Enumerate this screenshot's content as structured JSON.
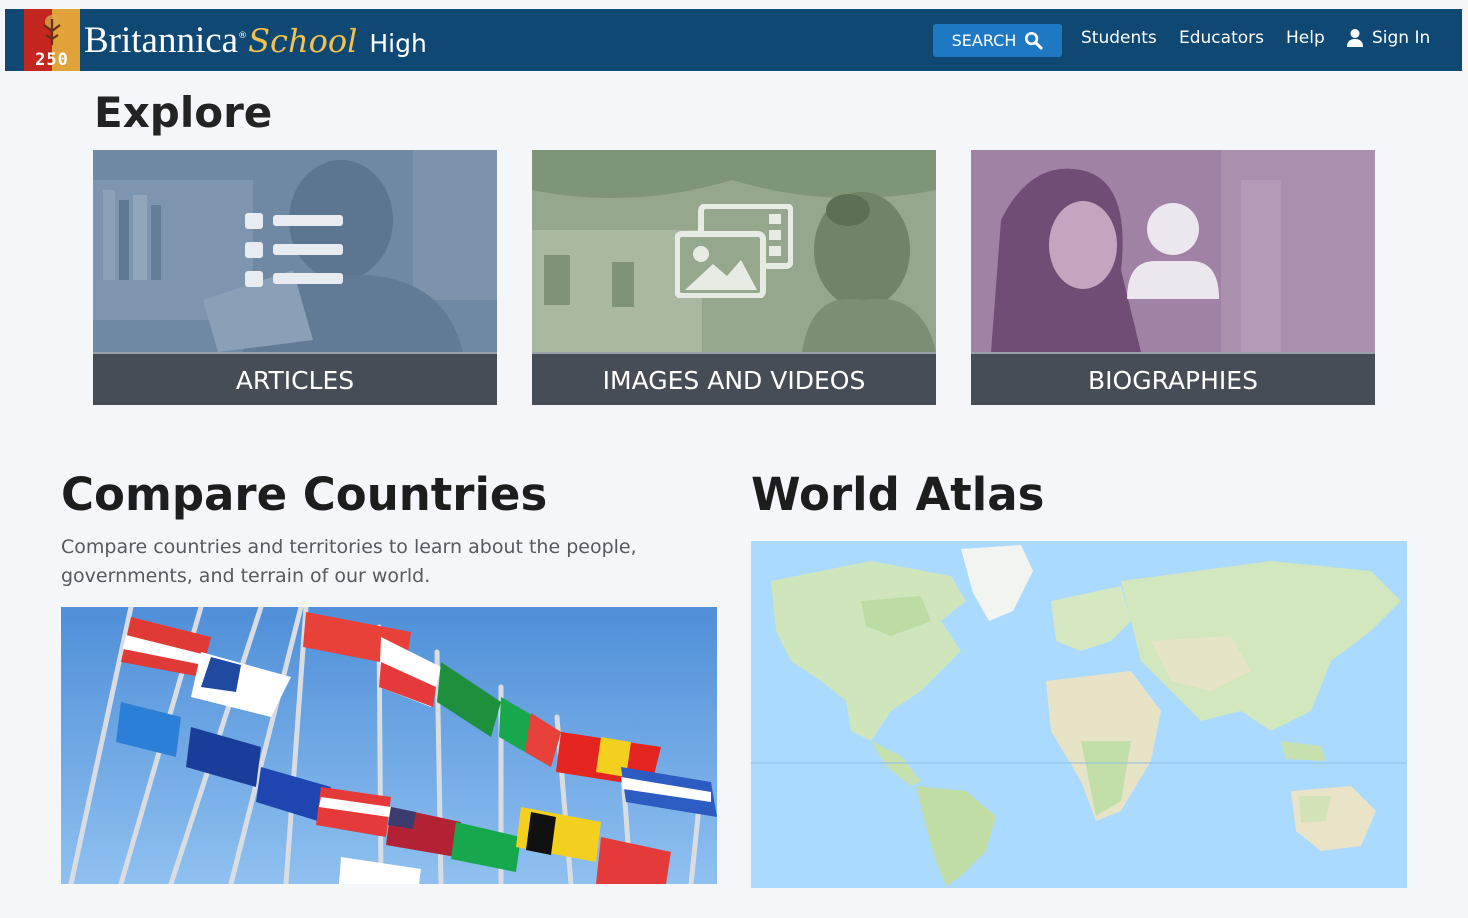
{
  "header": {
    "logo_number": "250",
    "brand_primary": "Britannica",
    "brand_reg": "®",
    "brand_secondary": "School",
    "brand_level": "High",
    "search_label": "SEARCH",
    "nav": [
      "Students",
      "Educators",
      "Help"
    ],
    "signin_label": "Sign In",
    "colors": {
      "bar": "#0e4873",
      "search": "#1e78c2",
      "accent": "#f2c14e"
    }
  },
  "explore": {
    "title": "Explore",
    "cards": [
      {
        "label": "ARTICLES",
        "icon": "list-icon",
        "tint": "#7089a4"
      },
      {
        "label": "IMAGES AND VIDEOS",
        "icon": "media-icon",
        "tint": "#93a68c"
      },
      {
        "label": "BIOGRAPHIES",
        "icon": "person-icon",
        "tint": "#9d7fa1"
      }
    ]
  },
  "compare": {
    "title": "Compare Countries",
    "description": "Compare countries and territories to learn about the people, governments, and terrain of our world."
  },
  "atlas": {
    "title": "World Atlas"
  }
}
